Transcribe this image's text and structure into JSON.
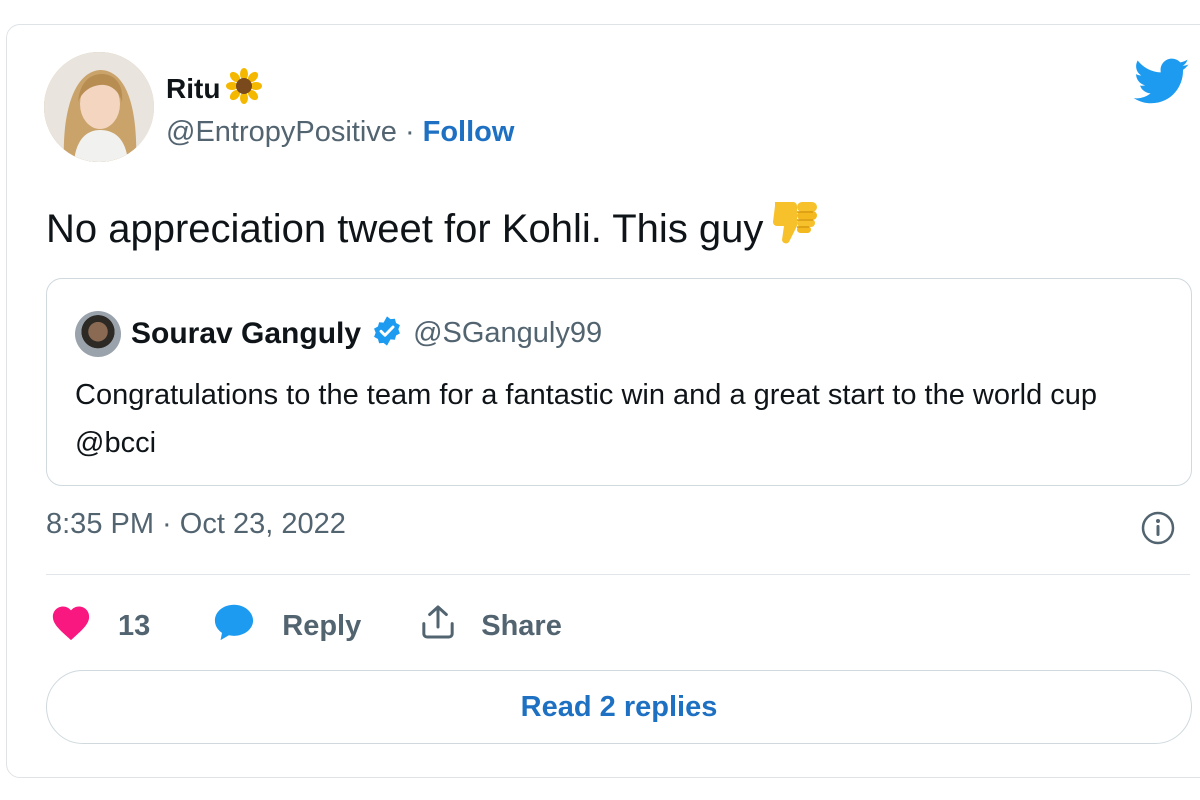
{
  "author": {
    "name": "Ritu",
    "handle": "@EntropyPositive",
    "separator": "·",
    "follow_label": "Follow",
    "name_emoji": "sunflower-icon"
  },
  "tweet": {
    "text": "No appreciation tweet for Kohli. This guy",
    "text_emoji": "thumbs-down-icon",
    "timestamp": "8:35 PM · Oct 23, 2022"
  },
  "quoted_tweet": {
    "name": "Sourav Ganguly",
    "handle": "@SGanguly99",
    "verified": true,
    "text": "Congratulations to the team for a fantastic win and a great start to the world cup @bcci"
  },
  "actions": {
    "like_count": "13",
    "reply_label": "Reply",
    "share_label": "Share"
  },
  "read_replies_label": "Read 2 replies",
  "colors": {
    "twitter_blue": "#1d9bf0",
    "link_blue": "#1d70c2",
    "heart_pink": "#f91880",
    "muted_text": "#536471",
    "border": "#cfd9de"
  }
}
